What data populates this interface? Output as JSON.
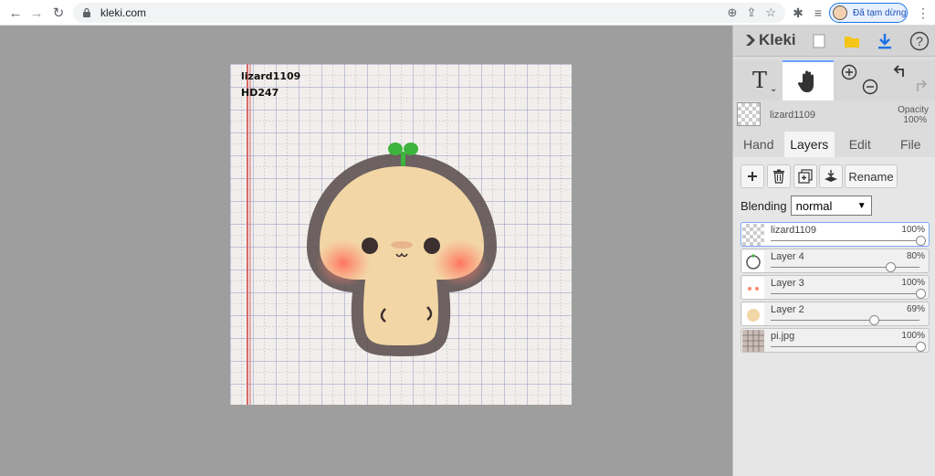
{
  "browser": {
    "url": "kleki.com",
    "profile_label": "Đã tạm dừng"
  },
  "canvas": {
    "caption_line1": "lizard1109",
    "caption_line2": "HD247"
  },
  "app": {
    "logo_text": "Kleki",
    "help_label": "?"
  },
  "tools": {
    "text_label": "T"
  },
  "current_layer": {
    "name": "lizard1109",
    "opacity_label": "Opacity",
    "opacity_value": "100%"
  },
  "tabs": [
    {
      "label": "Hand"
    },
    {
      "label": "Layers"
    },
    {
      "label": "Edit"
    },
    {
      "label": "File"
    }
  ],
  "layers_panel": {
    "rename_label": "Rename",
    "blending_label": "Blending",
    "blending_value": "normal"
  },
  "layers": [
    {
      "name": "lizard1109",
      "opacity": "100%",
      "level": 1.0
    },
    {
      "name": "Layer 4",
      "opacity": "80%",
      "level": 0.8
    },
    {
      "name": "Layer 3",
      "opacity": "100%",
      "level": 1.0
    },
    {
      "name": "Layer 2",
      "opacity": "69%",
      "level": 0.69
    },
    {
      "name": "pi.jpg",
      "opacity": "100%",
      "level": 1.0
    }
  ],
  "colors": {
    "accent": "#1a73e8",
    "selected_border": "#7ea8ff",
    "mushroom_leaf": "#3db43d"
  }
}
